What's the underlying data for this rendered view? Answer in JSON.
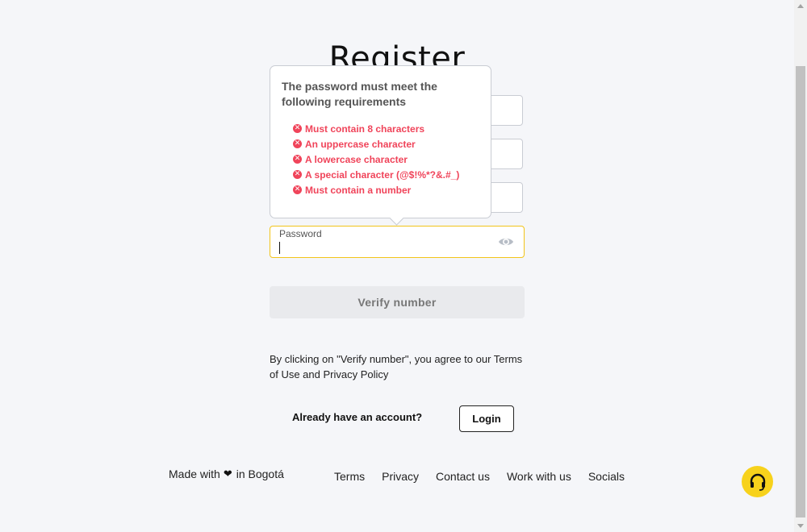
{
  "page": {
    "title": "Register"
  },
  "form": {
    "password_label": "Password",
    "password_value": "",
    "password_toggle_icon": "eye-icon"
  },
  "tooltip": {
    "heading": "The password must meet the following requirements",
    "requirements": [
      {
        "text": "Must contain 8 characters",
        "met": false
      },
      {
        "text": "An uppercase character",
        "met": false
      },
      {
        "text": "A lowercase character",
        "met": false
      },
      {
        "text": "A special character (@$!%*?&.#_)",
        "met": false
      },
      {
        "text": "Must contain a number",
        "met": false
      }
    ],
    "unmet_icon": "x-circle-icon",
    "error_color": "#f0445a"
  },
  "actions": {
    "verify_label": "Verify number",
    "terms_text": "By clicking on \"Verify number\", you agree to our Terms of Use and Privacy Policy",
    "account_prompt": "Already have an account?",
    "login_label": "Login"
  },
  "footer": {
    "made_with_prefix": "Made with",
    "made_with_icon": "heart-icon",
    "made_with_suffix": "in Bogotá",
    "links": [
      "Terms",
      "Privacy",
      "Contact us",
      "Work with us",
      "Socials"
    ],
    "help_icon": "headset-icon"
  },
  "colors": {
    "accent": "#f7d21c",
    "focus_border": "#f2c41a",
    "background": "#f5f6f9"
  }
}
